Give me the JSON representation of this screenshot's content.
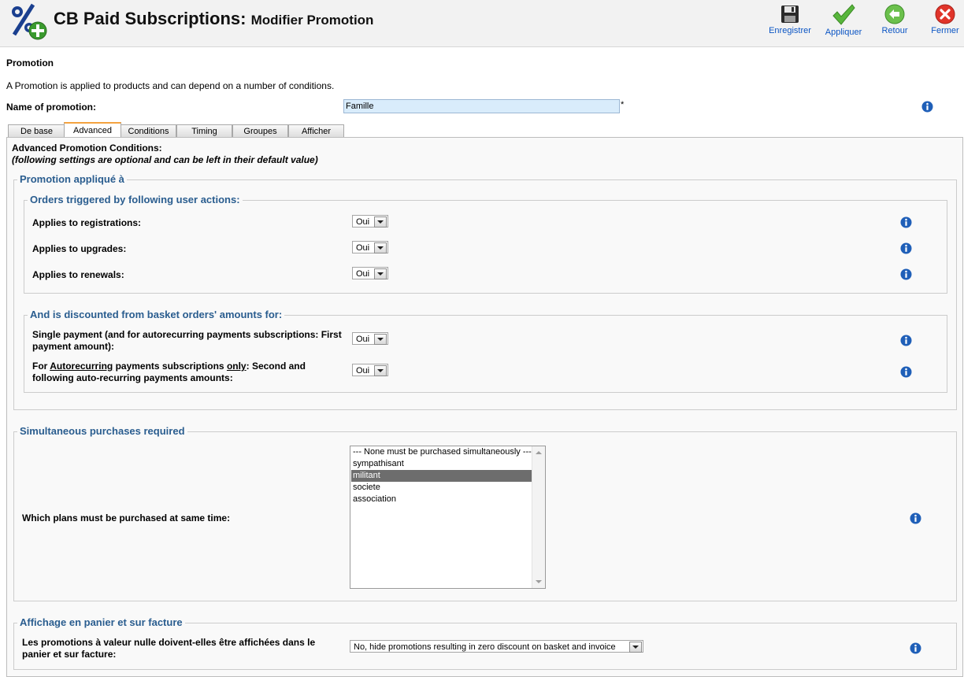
{
  "header": {
    "title": "CB Paid Subscriptions:",
    "subtitle": "Modifier Promotion",
    "logo_icon": "promotion-percent-logo"
  },
  "toolbar": {
    "save_label": "Enregistrer",
    "apply_label": "Appliquer",
    "back_label": "Retour",
    "close_label": "Fermer"
  },
  "form": {
    "section_label": "Promotion",
    "intro": "A Promotion is applied to products and can depend on a number of conditions.",
    "name_label": "Name of promotion:",
    "name_value": "Famille",
    "required_marker": "*"
  },
  "tabs": [
    {
      "label": "De base"
    },
    {
      "label": "Advanced"
    },
    {
      "label": "Conditions"
    },
    {
      "label": "Timing"
    },
    {
      "label": "Groupes"
    },
    {
      "label": "Afficher"
    }
  ],
  "active_tab": "Advanced",
  "advanced": {
    "title": "Advanced Promotion Conditions:",
    "note": "(following settings are optional and can be left in their default value)",
    "applied_legend": "Promotion appliqué à",
    "orders_legend": "Orders triggered by following user actions:",
    "registrations_label": "Applies to registrations:",
    "registrations_value": "Oui",
    "upgrades_label": "Applies to upgrades:",
    "upgrades_value": "Oui",
    "renewals_label": "Applies to renewals:",
    "renewals_value": "Oui",
    "discount_legend": "And is discounted from basket orders' amounts for:",
    "single_label": "Single payment (and for autorecurring payments subscriptions: First payment amount):",
    "single_value": "Oui",
    "recurring_prefix": "For ",
    "recurring_word": "Autorecurring",
    "recurring_mid": " payments subscriptions ",
    "recurring_only": "only",
    "recurring_suffix": ": Second and following auto-recurring payments amounts:",
    "recurring_value": "Oui",
    "simultaneous_legend": "Simultaneous purchases required",
    "plans_label": "Which plans must be purchased at same time:",
    "plans_options": [
      "--- None must be purchased simultaneously ---",
      "sympathisant",
      "militant",
      "societe",
      "association"
    ],
    "plans_selected": "militant",
    "display_legend": "Affichage en panier et sur facture",
    "zero_label": "Les promotions à valeur nulle doivent-elles être affichées dans le panier et sur facture:",
    "zero_value": "No, hide promotions resulting in zero discount on basket and invoice"
  },
  "colors": {
    "legend": "#2a5d8f",
    "active_tab_top": "#f4a340",
    "selected_option": "#6d6d6d",
    "name_input_bg": "#d9ecfb",
    "info_icon": "#1f5fb8"
  }
}
